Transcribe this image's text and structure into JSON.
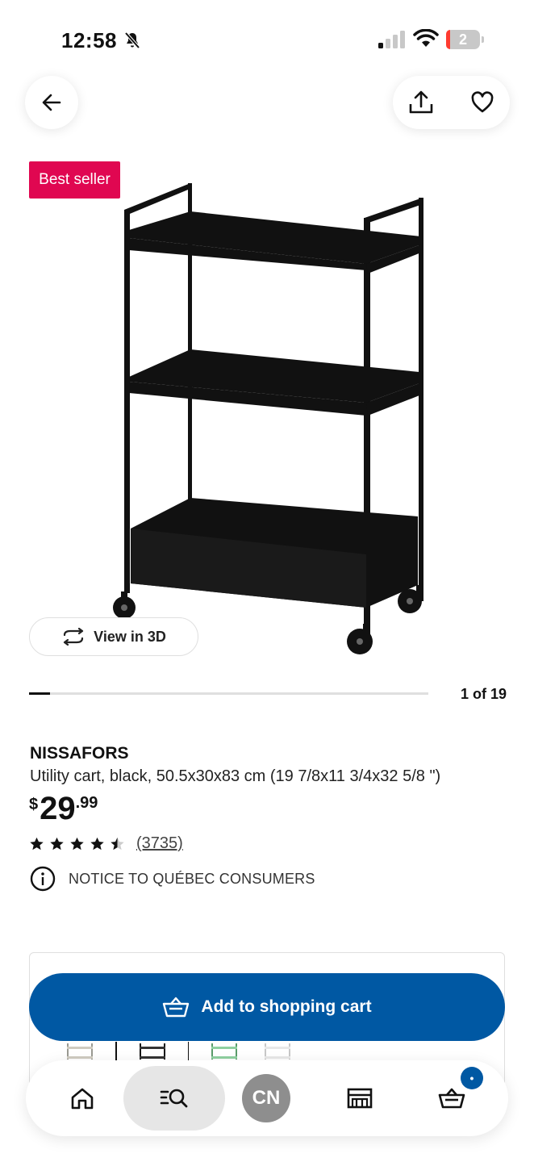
{
  "status_bar": {
    "time": "12:58",
    "battery_level": "2",
    "icons": [
      "bell-slash-icon",
      "signal-icon",
      "wifi-icon",
      "battery-icon"
    ]
  },
  "top_actions": {
    "icons": [
      "arrow-left-icon",
      "share-icon",
      "heart-icon"
    ]
  },
  "badge": {
    "label": "Best seller",
    "color": "#e00751"
  },
  "gallery": {
    "view3d_label": "View in 3D",
    "counter": "1 of 19",
    "progress_fraction": 0.053
  },
  "product": {
    "name": "NISSAFORS",
    "description": "Utility cart, black, 50.5x30x83 cm (19 7/8x11 3/4x32 5/8 \")",
    "price": {
      "currency": "$",
      "integer": "29",
      "decimal": ".99"
    },
    "rating": {
      "stars": 4.5,
      "max": 5,
      "count": "(3735)"
    },
    "notice": "NOTICE TO QUÉBEC CONSUMERS"
  },
  "purchase": {
    "add_to_cart_label": "Add to shopping cart",
    "button_color": "#0058a3"
  },
  "bottom_nav": {
    "profile_initials": "CN",
    "cart_badge": "•",
    "icons": [
      "home-icon",
      "search-icon",
      "store-icon",
      "cart-icon"
    ]
  }
}
